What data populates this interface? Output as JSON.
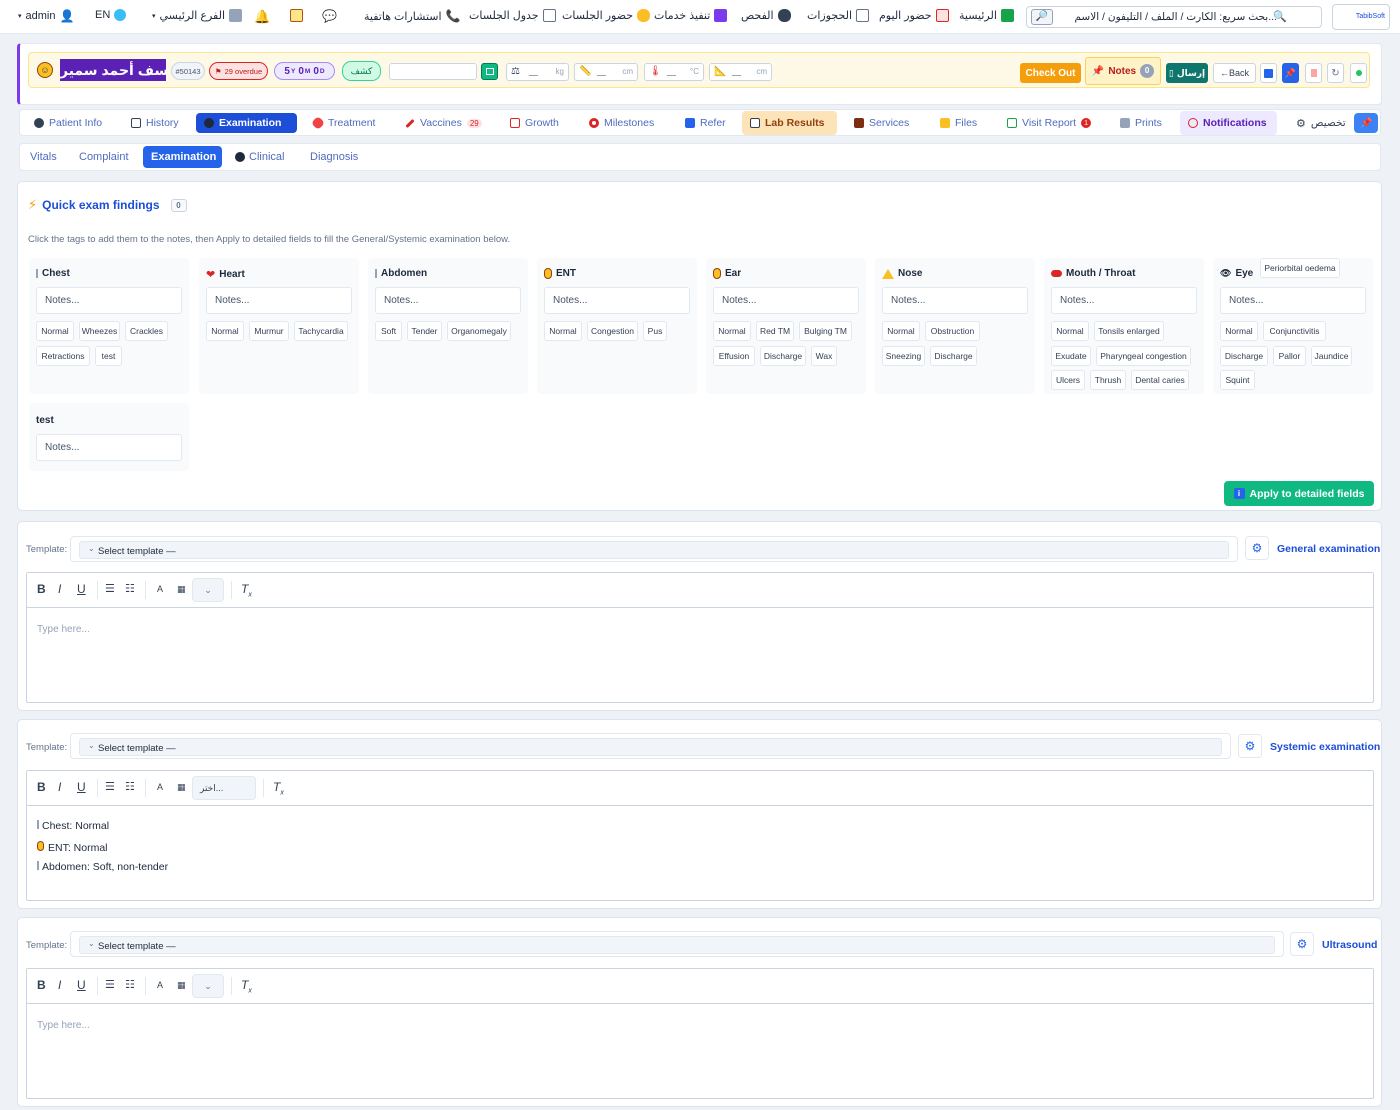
{
  "topnav": {
    "user": "admin",
    "lang": "EN",
    "branch": "الفرع الرئيسي",
    "items": {
      "phone": "استشارات هاتفية",
      "sessions_table": "جدول الجلسات",
      "sessions_attendance": "حضور الجلسات",
      "services": "تنفيذ خدمات",
      "exam": "الفحص",
      "bookings": "الحجوزات",
      "today": "حضور اليوم",
      "home": "الرئيسية"
    },
    "quick_search": "بحث سريع: الكارت / الملف / التليفون / الاسم...",
    "logo": "TabibSoft"
  },
  "patient": {
    "name": "يوسف أحمد سمير",
    "id": "#50143",
    "overdue": "29 overdue",
    "age_y": "5",
    "age_y_unit": "Y",
    "age_m": "0",
    "age_m_unit": "M",
    "age_d": "0",
    "age_d_unit": "D",
    "visit_type": "كشف",
    "vitals": [
      {
        "dash": "__",
        "unit": "kg"
      },
      {
        "dash": "__",
        "unit": "cm"
      },
      {
        "dash": "__",
        "unit": "°C"
      },
      {
        "dash": "__",
        "unit": "cm"
      }
    ],
    "checkout": "Check Out",
    "notes_label": "Notes",
    "notes_count": "0",
    "send": "إرسال",
    "back": "←Back"
  },
  "main_tabs": {
    "patient_info": "Patient Info",
    "history": "History",
    "examination": "Examination",
    "treatment": "Treatment",
    "vaccines": "Vaccines",
    "vaccines_badge": "29",
    "growth": "Growth",
    "milestones": "Milestones",
    "refer": "Refer",
    "lab_results": "Lab Results",
    "services": "Services",
    "files": "Files",
    "visit_report": "Visit Report",
    "visit_report_badge": "1",
    "prints": "Prints",
    "notifications": "Notifications",
    "customize": "تخصيص"
  },
  "sub_tabs": {
    "vitals": "Vitals",
    "complaint": "Complaint",
    "examination": "Examination",
    "clinical": "Clinical",
    "diagnosis": "Diagnosis"
  },
  "quick_findings": {
    "title": "Quick exam findings",
    "count": "0",
    "help": "Click the tags to add them to the notes, then Apply to detailed fields to fill the General/Systemic examination below.",
    "notes_placeholder": "Notes...",
    "apply": "Apply to detailed fields",
    "cards": {
      "chest": {
        "title": "Chest",
        "chips": [
          "Normal",
          "Wheezes",
          "Crackles",
          "Retractions",
          "test"
        ]
      },
      "heart": {
        "title": "Heart",
        "chips": [
          "Normal",
          "Murmur",
          "Tachycardia"
        ]
      },
      "abdomen": {
        "title": "Abdomen",
        "chips": [
          "Soft",
          "Tender",
          "Organomegaly"
        ]
      },
      "ent": {
        "title": "ENT",
        "chips": [
          "Normal",
          "Congestion",
          "Pus"
        ]
      },
      "ear": {
        "title": "Ear",
        "chips": [
          "Normal",
          "Red TM",
          "Bulging TM",
          "Effusion",
          "Discharge",
          "Wax"
        ]
      },
      "nose": {
        "title": "Nose",
        "chips": [
          "Normal",
          "Obstruction",
          "Sneezing",
          "Discharge"
        ]
      },
      "mouth": {
        "title": "Mouth / Throat",
        "chips": [
          "Normal",
          "Tonsils enlarged",
          "Exudate",
          "Pharyngeal congestion",
          "Ulcers",
          "Thrush",
          "Dental caries"
        ]
      },
      "eye": {
        "title": "Eye",
        "chips": [
          "Normal",
          "Conjunctivitis",
          "Discharge",
          "Pallor",
          "Jaundice",
          "Squint",
          "Periorbital oedema"
        ]
      },
      "test": {
        "title": "test",
        "chips": []
      }
    }
  },
  "editors": {
    "template_label": "Template:",
    "select_template": "Select template —",
    "placeholder": "Type here...",
    "general": {
      "title": "General examination"
    },
    "systemic": {
      "title": "Systemic examination",
      "dropdown": "اختر...",
      "lines": [
        "Chest: Normal",
        "ENT: Normal",
        "Abdomen: Soft, non-tender"
      ]
    },
    "ultrasound": {
      "title": "Ultrasound"
    }
  },
  "colors": {
    "primary": "#1d4ed8",
    "success": "#10b981",
    "warning": "#f59e0b",
    "accent_purple": "#7c3aed"
  }
}
